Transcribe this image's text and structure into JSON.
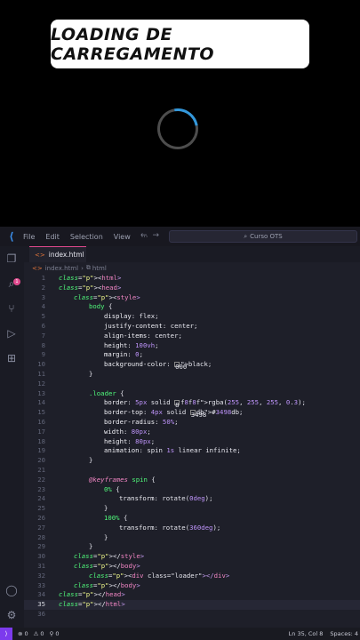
{
  "preview": {
    "title": "LOADING DE CARREGAMENTO"
  },
  "titlebar": {
    "menu": [
      "File",
      "Edit",
      "Selection",
      "View",
      "···"
    ],
    "search": "Curso OTS"
  },
  "activity_bar": {
    "badge": "1"
  },
  "tab": {
    "label": "index.html"
  },
  "breadcrumb": {
    "file": "index.html",
    "element": "html"
  },
  "code": {
    "active_line": 35,
    "lines": [
      "<html>",
      "<head>",
      "<style>",
      "body {",
      "display: flex;",
      "justify-content: center;",
      "align-items: center;",
      "height: 100vh;",
      "margin: 0;",
      "background-color: black;",
      "}",
      "",
      ".loader {",
      "border: 5px solid rgba(255, 255, 255, 0.3);",
      "border-top: 4px solid #3498db;",
      "border-radius: 50%;",
      "width: 80px;",
      "height: 80px;",
      "animation: spin 1s linear infinite;",
      "}",
      "",
      "@keyframes spin {",
      "0% {",
      "transform: rotate(0deg);",
      "}",
      "100% {",
      "transform: rotate(360deg);",
      "}",
      "}",
      "</style>",
      "</body>",
      "<div class=\"loader\"></div>",
      "</body>",
      "</head>",
      "</html>",
      ""
    ]
  },
  "statusbar": {
    "errors": "0",
    "warnings": "0",
    "ports": "0",
    "position": "Ln 35, Col 8",
    "spaces": "Spaces: 4"
  },
  "colors": {
    "accent_pink": "#e24a8f",
    "loader_blue": "#3498db",
    "editor_bg": "#1e1f29"
  }
}
